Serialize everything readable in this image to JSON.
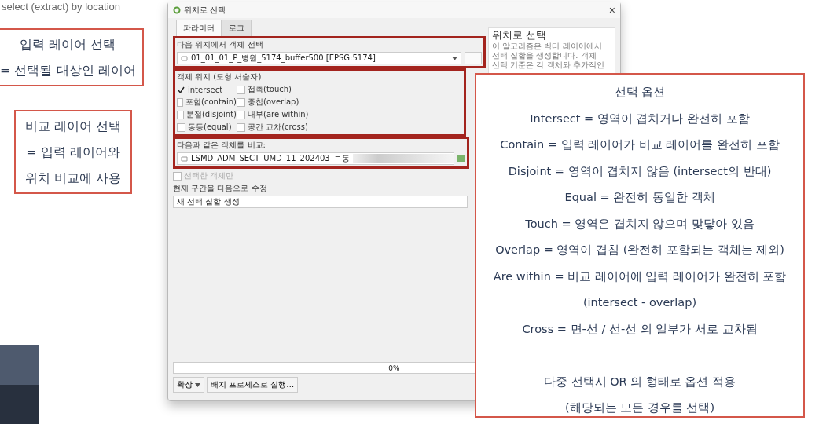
{
  "caption": "select (extract) by location",
  "notes": [
    {
      "lines": [
        "입력 레이어 선택",
        "= 선택될 대상인 레이어"
      ]
    },
    {
      "lines": [
        "비교 레이어 선택",
        "= 입력 레이어와",
        "위치 비교에 사용"
      ]
    }
  ],
  "dialog": {
    "title": "위치로 선택",
    "close": "×",
    "tabs": [
      {
        "label": "파라미터",
        "selected": true
      },
      {
        "label": "로그",
        "selected": false
      }
    ],
    "input_label": "다음 위치에서 객체 선택",
    "input_layer": "01_01_01_P_병원_5174_buffer500 [EPSG:5174]",
    "more": "…",
    "predicate_label": "객체 위치 (도형 서술자)",
    "predicates": [
      {
        "label": "intersect",
        "checked": true
      },
      {
        "label": "접촉(touch)",
        "checked": false
      },
      {
        "label": "포함(contain)",
        "checked": false
      },
      {
        "label": "중첩(overlap)",
        "checked": false
      },
      {
        "label": "분절(disjoint)",
        "checked": false
      },
      {
        "label": "내부(are within)",
        "checked": false
      },
      {
        "label": "동등(equal)",
        "checked": false
      },
      {
        "label": "공간 교차(cross)",
        "checked": false
      }
    ],
    "compare_label": "다음과 같은 객체를 비교:",
    "compare_layer": "LSMD_ADM_SECT_UMD_11_202403_ㄱ동",
    "selected_only": {
      "label": "선택한 객체만",
      "checked": false,
      "disabled": true
    },
    "modify_label": "현재 구간을 다음으로 수정",
    "modify_value": "새 선택 집합 생성",
    "help_title": "위치로 선택",
    "help_lines": [
      "이 알고리즘은 벡터 레이어에서",
      "선택 집합을 생성합니다. 객체",
      "선택 기준은 각 객체와 추가적인"
    ],
    "progress": {
      "level": 0,
      "text": "0%"
    },
    "buttons": [
      {
        "label": "확장",
        "kind": "menu"
      },
      {
        "label": "배치 프로세스로 실행…",
        "kind": "plain"
      }
    ]
  },
  "callout": {
    "title": "선택 옵션",
    "lines": [
      "Intersect = 영역이 겹치거나 완전히 포함",
      "Contain = 입력 레이어가 비교 레이어를 완전히 포함",
      "Disjoint = 영역이 겹치지 않음 (intersect의 반대)",
      "Equal = 완전히 동일한 객체",
      "Touch = 영역은 겹치지 않으며 맞닿아 있음",
      "Overlap = 영역이 겹침 (완전히 포함되는 객체는 제외)",
      "Are within = 비교 레이어에 입력 레이어가 완전히 포함",
      "(intersect - overlap)",
      "Cross = 면-선 / 선-선 의 일부가 서로 교차됨"
    ],
    "footer": [
      "다중 선택시 OR 의 형태로 옵션 적용",
      "(해당되는 모든 경우를 선택)"
    ]
  }
}
